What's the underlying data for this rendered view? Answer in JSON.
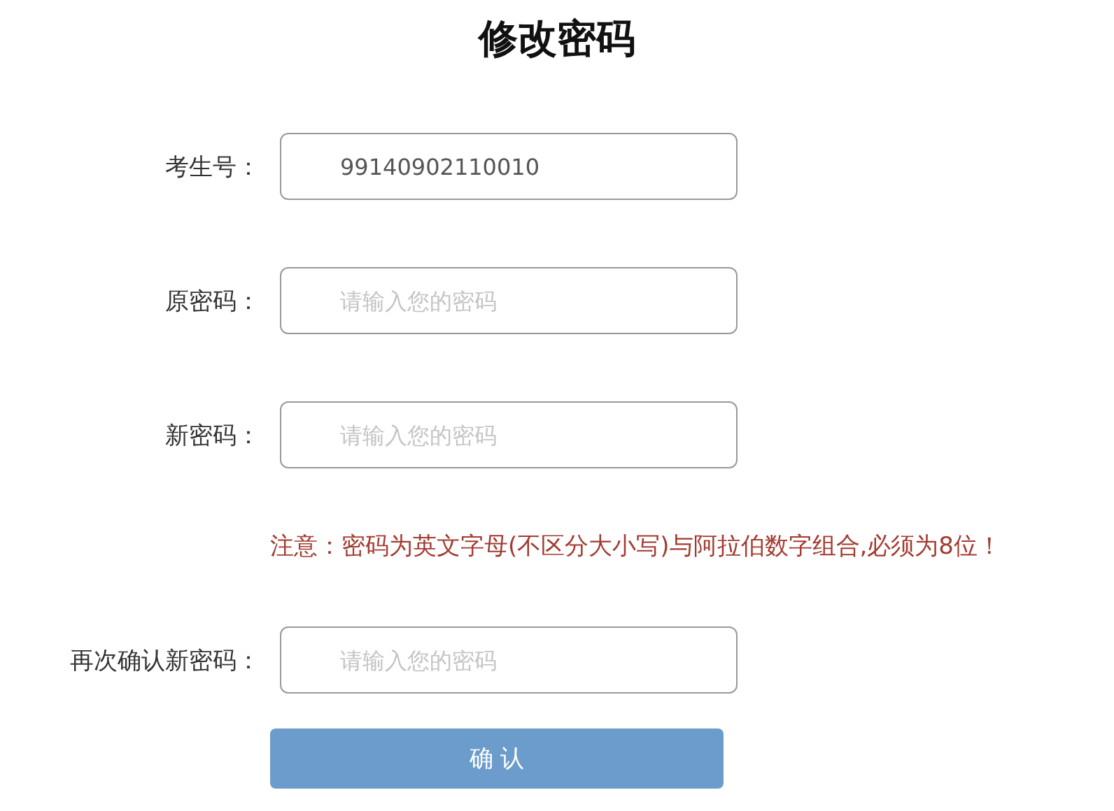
{
  "title": "修改密码",
  "items": [
    {
      "kind": "field",
      "label": "考生号：",
      "value": "99140902110010"
    },
    {
      "kind": "field",
      "label": "原密码：",
      "placeholder": "请输入您的密码"
    },
    {
      "kind": "field",
      "label": "新密码：",
      "placeholder": "请输入您的密码"
    },
    {
      "kind": "note",
      "text": "注意：密码为英文字母(不区分大小写)与阿拉伯数字组合,必须为8位！"
    },
    {
      "kind": "field",
      "label": "再次确认新密码：",
      "placeholder": "请输入您的密码"
    }
  ],
  "button": "确 认"
}
